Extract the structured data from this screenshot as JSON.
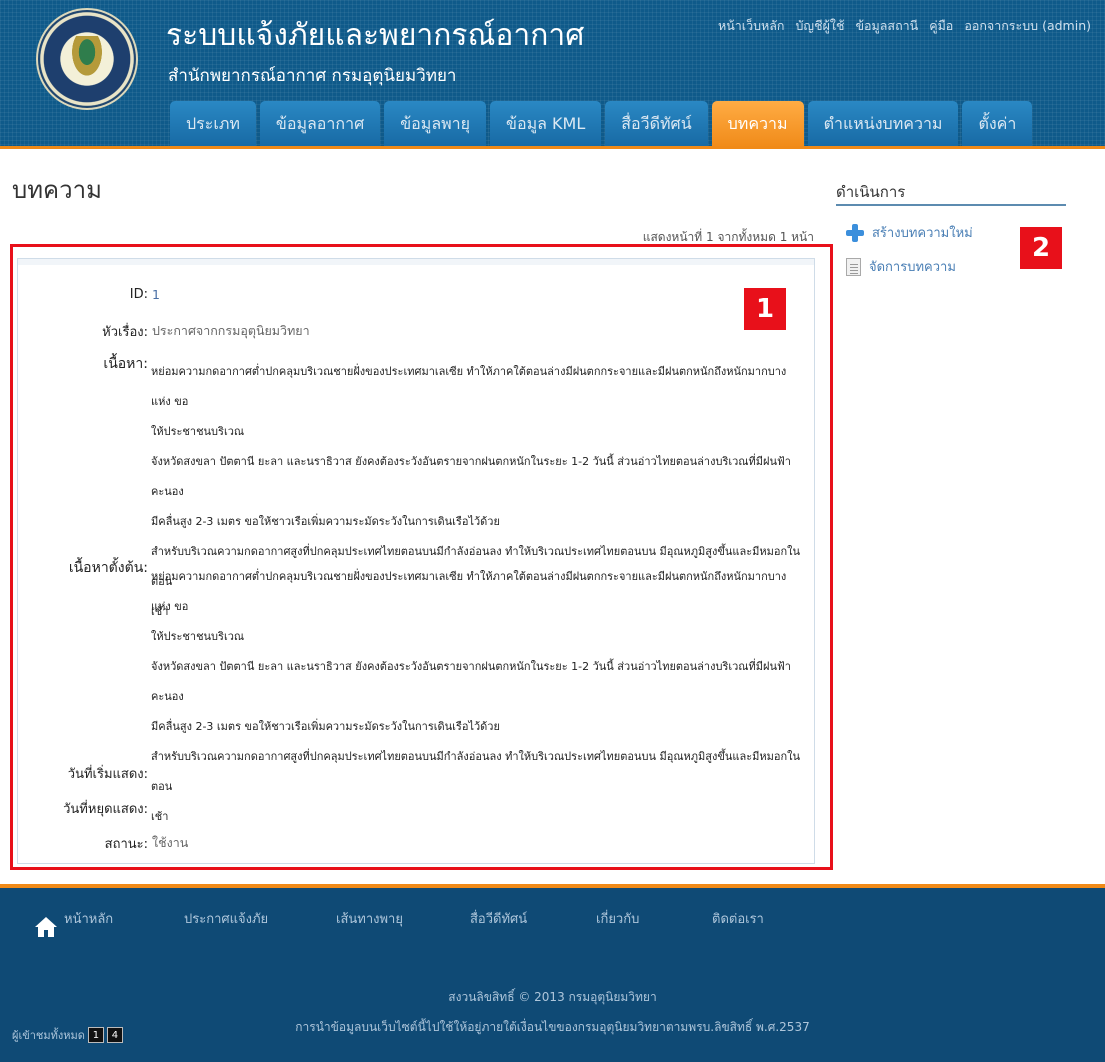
{
  "header": {
    "title": "ระบบแจ้งภัยและพยากรณ์อากาศ",
    "subtitle": "สำนักพยากรณ์อากาศ กรมอุตุนิยมวิทยา",
    "logo_text": "METEOROLOGICAL DEPARTMENT",
    "top_links": [
      "หน้าเว็บหลัก",
      "บัญชีผู้ใช้",
      "ข้อมูลสถานี",
      "คู่มือ",
      "ออกจากระบบ (admin)"
    ],
    "tabs": [
      "ประเภท",
      "ข้อมูลอากาศ",
      "ข้อมูลพายุ",
      "ข้อมูล KML",
      "สื่อวีดีทัศน์",
      "บทความ",
      "ตำแหน่งบทความ",
      "ตั้งค่า"
    ],
    "active_tab": "บทความ"
  },
  "main": {
    "page_title": "บทความ",
    "pager_info": "แสดงหน้าที่ 1 จากทั้งหมด 1 หน้า",
    "detail": {
      "id_label": "ID:",
      "id_value": "1",
      "subject_label": "หัวเรื่อง:",
      "subject_value": "ประกาศจากกรมอุตุนิยมวิทยา",
      "content_label": "เนื้อหา:",
      "content_lines": [
        "หย่อมความกดอากาศต่ำปกคลุมบริเวณชายฝั่งของประเทศมาเลเซีย ทำให้ภาคใต้ตอนล่างมีฝนตกกระจายและมีฝนตกหนักถึงหนักมากบางแห่ง ขอ",
        "ให้ประชาชนบริเวณ",
        "จังหวัดสงขลา ปัตตานี ยะลา และนราธิวาส ยังคงต้องระวังอันตรายจากฝนตกหนักในระยะ 1-2 วันนี้ ส่วนอ่าวไทยตอนล่างบริเวณที่มีฝนฟ้าคะนอง",
        "มีคลื่นสูง 2-3 เมตร ขอให้ชาวเรือเพิ่มความระมัดระวังในการเดินเรือไว้ด้วย",
        "สำหรับบริเวณความกดอากาศสูงที่ปกคลุมประเทศไทยตอนบนมีกำลังอ่อนลง ทำให้บริเวณประเทศไทยตอนบน มีอุณหภูมิสูงขึ้นและมีหมอกในตอน",
        "เช้า"
      ],
      "original_label": "เนื้อหาตั้งต้น:",
      "original_lines": [
        "หย่อมความกดอากาศต่ำปกคลุมบริเวณชายฝั่งของประเทศมาเลเซีย ทำให้ภาคใต้ตอนล่างมีฝนตกกระจายและมีฝนตกหนักถึงหนักมากบางแห่ง ขอ",
        "ให้ประชาชนบริเวณ",
        "จังหวัดสงขลา ปัตตานี ยะลา และนราธิวาส ยังคงต้องระวังอันตรายจากฝนตกหนักในระยะ 1-2 วันนี้ ส่วนอ่าวไทยตอนล่างบริเวณที่มีฝนฟ้าคะนอง",
        "มีคลื่นสูง 2-3 เมตร ขอให้ชาวเรือเพิ่มความระมัดระวังในการเดินเรือไว้ด้วย",
        "สำหรับบริเวณความกดอากาศสูงที่ปกคลุมประเทศไทยตอนบนมีกำลังอ่อนลง ทำให้บริเวณประเทศไทยตอนบน มีอุณหภูมิสูงขึ้นและมีหมอกในตอน",
        "เช้า"
      ],
      "start_label": "วันที่เริ่มแสดง:",
      "stop_label": "วันที่หยุดแสดง:",
      "status_label": "สถานะ:",
      "status_value": "ใช้งาน"
    }
  },
  "sidebar": {
    "title": "ดำเนินการ",
    "items": [
      "สร้างบทความใหม่",
      "จัดการบทความ"
    ]
  },
  "annotations": [
    "1",
    "2"
  ],
  "footer": {
    "nav": [
      "หน้าหลัก",
      "ประกาศแจ้งภัย",
      "เส้นทางพายุ",
      "สื่อวีดีทัศน์",
      "เกี่ยวกับ",
      "ติดต่อเรา"
    ],
    "copyright": "สงวนลิขสิทธิ์ © 2013 กรมอุตุนิยมวิทยา",
    "notice": "การนำข้อมูลบนเว็บไซต์นี้ไปใช้ให้อยู่ภายใต้เงื่อนไขของกรมอุตุนิยมวิทยาตามพรบ.ลิขสิทธิ์ พ.ศ.2537",
    "visitors_label": "ผู้เข้าชมทั้งหมด",
    "visitors_digits": [
      "1",
      "4"
    ]
  },
  "colors": {
    "header_blue": "#0f5a8a",
    "tab_blue": "#1e78b4",
    "accent_orange": "#f08a18",
    "footer_blue": "#0f4a75",
    "highlight_red": "#e8101a"
  }
}
